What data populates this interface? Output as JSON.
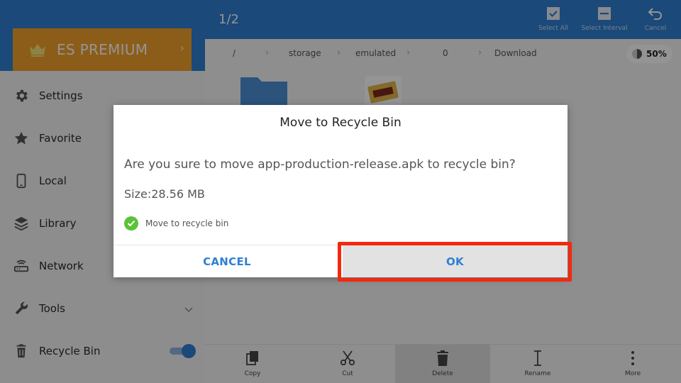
{
  "sidebar": {
    "premium_label": "ES PREMIUM",
    "items": [
      {
        "label": "Settings",
        "icon": "gear-icon"
      },
      {
        "label": "Favorite",
        "icon": "star-icon"
      },
      {
        "label": "Local",
        "icon": "phone-icon"
      },
      {
        "label": "Library",
        "icon": "layers-icon"
      },
      {
        "label": "Network",
        "icon": "router-icon"
      },
      {
        "label": "Tools",
        "icon": "wrench-icon"
      },
      {
        "label": "Recycle Bin",
        "icon": "trash-icon"
      }
    ],
    "recycle_bin_toggle_on": true
  },
  "topbar": {
    "counter": "1/2",
    "actions": [
      {
        "label": "Select All",
        "icon": "select-all-icon"
      },
      {
        "label": "Select Interval",
        "icon": "select-interval-icon"
      },
      {
        "label": "Cancel",
        "icon": "undo-icon"
      }
    ]
  },
  "breadcrumb": [
    "/",
    "storage",
    "emulated",
    "0",
    "Download"
  ],
  "storage_usage": "50%",
  "bottombar": [
    {
      "label": "Copy",
      "icon": "copy-icon"
    },
    {
      "label": "Cut",
      "icon": "scissors-icon"
    },
    {
      "label": "Delete",
      "icon": "trash-icon"
    },
    {
      "label": "Rename",
      "icon": "text-cursor-icon"
    },
    {
      "label": "More",
      "icon": "more-vertical-icon"
    }
  ],
  "dialog": {
    "title": "Move to Recycle Bin",
    "message": "Are you sure to move app-production-release.apk to recycle bin?",
    "size": "Size:28.56 MB",
    "checkbox_label": "Move to recycle bin",
    "checkbox_checked": true,
    "cancel_label": "CANCEL",
    "ok_label": "OK"
  },
  "colors": {
    "accent_blue": "#2f7fd0",
    "premium_orange": "#f2a12a",
    "check_green": "#5cc23a",
    "highlight_red": "#f4280f"
  }
}
